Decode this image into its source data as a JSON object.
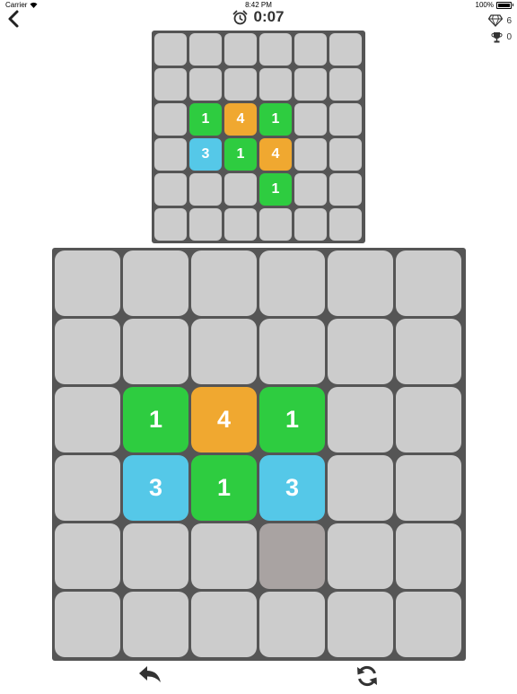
{
  "status_bar": {
    "carrier": "Carrier",
    "time": "8:42 PM",
    "battery": "100%"
  },
  "timer": {
    "value": "0:07"
  },
  "stats": {
    "gems": "6",
    "trophies": "0"
  },
  "colors": {
    "empty": "#cccccc",
    "green": "#2ecc40",
    "orange": "#f0a830",
    "blue": "#55c8e8",
    "highlight": "#a9a3a2"
  },
  "target_board": {
    "rows": 6,
    "cols": 6,
    "tiles": [
      {
        "row": 2,
        "col": 1,
        "value": "1",
        "color": "green"
      },
      {
        "row": 2,
        "col": 2,
        "value": "4",
        "color": "orange"
      },
      {
        "row": 2,
        "col": 3,
        "value": "1",
        "color": "green"
      },
      {
        "row": 3,
        "col": 1,
        "value": "3",
        "color": "blue"
      },
      {
        "row": 3,
        "col": 2,
        "value": "1",
        "color": "green"
      },
      {
        "row": 3,
        "col": 3,
        "value": "4",
        "color": "orange"
      },
      {
        "row": 4,
        "col": 3,
        "value": "1",
        "color": "green"
      }
    ]
  },
  "play_board": {
    "rows": 6,
    "cols": 6,
    "tiles": [
      {
        "row": 2,
        "col": 1,
        "value": "1",
        "color": "green"
      },
      {
        "row": 2,
        "col": 2,
        "value": "4",
        "color": "orange"
      },
      {
        "row": 2,
        "col": 3,
        "value": "1",
        "color": "green"
      },
      {
        "row": 3,
        "col": 1,
        "value": "3",
        "color": "blue"
      },
      {
        "row": 3,
        "col": 2,
        "value": "1",
        "color": "green"
      },
      {
        "row": 3,
        "col": 3,
        "value": "3",
        "color": "blue"
      },
      {
        "row": 4,
        "col": 3,
        "value": "",
        "color": "highlight"
      }
    ]
  },
  "controls": {
    "undo_icon": "undo-icon",
    "restart_icon": "refresh-icon"
  }
}
